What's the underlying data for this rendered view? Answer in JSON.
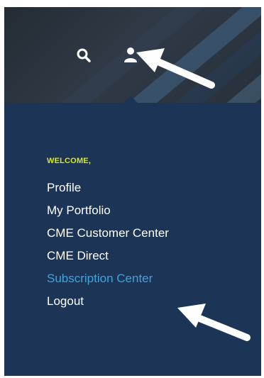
{
  "header": {
    "search_icon": "search-icon",
    "user_icon": "user-icon"
  },
  "menu": {
    "welcome": "WELCOME,",
    "items": [
      {
        "label": "Profile"
      },
      {
        "label": "My Portfolio"
      },
      {
        "label": "CME Customer Center"
      },
      {
        "label": "CME Direct"
      },
      {
        "label": "Subscription Center",
        "highlighted": true
      },
      {
        "label": "Logout"
      }
    ]
  },
  "colors": {
    "panel_bg": "#1c3557",
    "welcome": "#d6e52a",
    "menu_text": "#ffffff",
    "highlight": "#3fa2dc",
    "arrow": "#ffffff"
  },
  "annotations": {
    "arrow_icons": [
      "pointer-arrow-icon",
      "pointer-arrow-icon"
    ]
  }
}
